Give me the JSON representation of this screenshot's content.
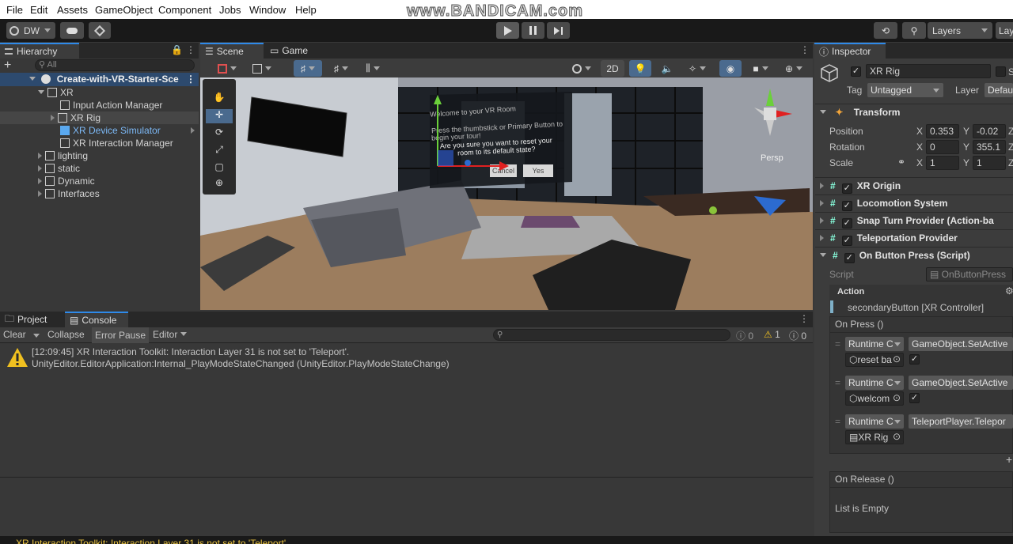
{
  "menu": [
    "File",
    "Edit",
    "Assets",
    "GameObject",
    "Component",
    "Jobs",
    "Window",
    "Help"
  ],
  "watermark": "www.BANDICAM.com",
  "toolbar": {
    "account": "DW",
    "layers": "Layers",
    "layout": "Lay"
  },
  "hierarchy": {
    "tab": "Hierarchy",
    "search_placeholder": "All",
    "scene": "Create-with-VR-Starter-Sce",
    "items": [
      {
        "label": "XR"
      },
      {
        "label": "Input Action Manager"
      },
      {
        "label": "XR Rig"
      },
      {
        "label": "XR Device Simulator"
      },
      {
        "label": "XR Interaction Manager"
      },
      {
        "label": "lighting"
      },
      {
        "label": "static"
      },
      {
        "label": "Dynamic"
      },
      {
        "label": "Interfaces"
      }
    ]
  },
  "scene_view": {
    "tabs": [
      "Scene",
      "Game"
    ],
    "mode_2d": "2D",
    "ui_panel": {
      "title": "Welcome to your VR Room",
      "line": "Press the thumbstick or Primary Button to",
      "line2": "begin your tour!",
      "question": "Are you sure you want to reset your room to its default state?",
      "cancel": "Cancel",
      "yes": "Yes"
    },
    "persp": "Persp"
  },
  "console": {
    "tabs": [
      "Project",
      "Console"
    ],
    "clear": "Clear",
    "collapse": "Collapse",
    "error_pause": "Error Pause",
    "editor": "Editor",
    "count_info": "0",
    "count_warn": "1",
    "count_error": "0",
    "message_line1": "[12:09:45] XR Interaction Toolkit: Interaction Layer 31 is not set to 'Teleport'.",
    "message_line2": "UnityEditor.EditorApplication:Internal_PlayModeStateChanged (UnityEditor.PlayModeStateChange)",
    "status_bar": "XR Interaction Toolkit: Interaction Layer 31 is not set to 'Teleport'."
  },
  "inspector": {
    "tab": "Inspector",
    "object_name": "XR Rig",
    "static_label": "S",
    "tag_label": "Tag",
    "tag_value": "Untagged",
    "layer_label": "Layer",
    "layer_value": "Defau",
    "transform": {
      "title": "Transform",
      "position_label": "Position",
      "rotation_label": "Rotation",
      "scale_label": "Scale",
      "pos_x": "0.353",
      "pos_y": "-0.02",
      "rot_x": "0",
      "rot_y": "355.1",
      "scale_x": "1",
      "scale_y": "1",
      "x": "X",
      "y": "Y",
      "z": "Z"
    },
    "components": [
      "XR Origin",
      "Locomotion System",
      "Snap Turn Provider (Action-ba",
      "Teleportation Provider",
      "On Button Press (Script)"
    ],
    "script_label": "Script",
    "script_value": "OnButtonPress",
    "action_label": "Action",
    "action_value": "secondaryButton [XR Controller]",
    "on_press": "On Press ()",
    "events": [
      {
        "mode": "Runtime C",
        "function": "GameObject.SetActive",
        "target": "reset ba"
      },
      {
        "mode": "Runtime C",
        "function": "GameObject.SetActive",
        "target": "welcom"
      },
      {
        "mode": "Runtime C",
        "function": "TeleportPlayer.Telepor",
        "target": "XR Rig"
      }
    ],
    "on_release": "On Release ()",
    "list_empty": "List is Empty"
  }
}
